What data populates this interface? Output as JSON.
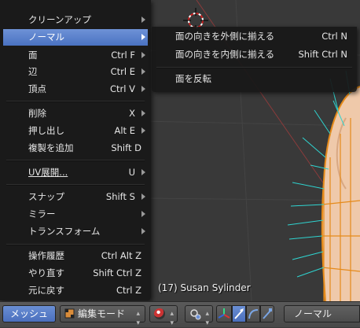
{
  "mesh_menu": {
    "items": [
      {
        "label": "クリーンアップ",
        "shortcut": "",
        "submenu": true
      },
      {
        "label": "ノーマル",
        "shortcut": "",
        "submenu": true,
        "active": true
      },
      {
        "label": "面",
        "shortcut": "Ctrl F",
        "submenu": true
      },
      {
        "label": "辺",
        "shortcut": "Ctrl E",
        "submenu": true
      },
      {
        "label": "頂点",
        "shortcut": "Ctrl V",
        "submenu": true
      },
      {
        "label": "削除",
        "shortcut": "X",
        "submenu": true
      },
      {
        "label": "押し出し",
        "shortcut": "Alt E",
        "submenu": true
      },
      {
        "label": "複製を追加",
        "shortcut": "Shift D",
        "submenu": false
      },
      {
        "label": "UV展開...",
        "shortcut": "U",
        "submenu": true
      },
      {
        "label": "スナップ",
        "shortcut": "Shift S",
        "submenu": true
      },
      {
        "label": "ミラー",
        "shortcut": "",
        "submenu": true
      },
      {
        "label": "トランスフォーム",
        "shortcut": "",
        "submenu": true
      },
      {
        "label": "操作履歴",
        "shortcut": "Ctrl Alt Z",
        "submenu": false
      },
      {
        "label": "やり直す",
        "shortcut": "Shift Ctrl Z",
        "submenu": false
      },
      {
        "label": "元に戻す",
        "shortcut": "Ctrl Z",
        "submenu": false
      }
    ]
  },
  "normals_menu": {
    "items": [
      {
        "label": "面の向きを外側に揃える",
        "shortcut": "Ctrl N"
      },
      {
        "label": "面の向きを内側に揃える",
        "shortcut": "Shift Ctrl N"
      },
      {
        "label": "面を反転",
        "shortcut": ""
      }
    ]
  },
  "viewport": {
    "object_info": "(17) Susan Sylinder"
  },
  "header": {
    "mesh_menu_label": "メッシュ",
    "mode_label": "編集モード",
    "orientation_label": "ノーマル"
  },
  "colors": {
    "menu_highlight": "#5680d0",
    "mesh_fill": "#f0c8a8",
    "mesh_wire": "#e58a1a",
    "normal_lines": "#2fd4d0"
  }
}
